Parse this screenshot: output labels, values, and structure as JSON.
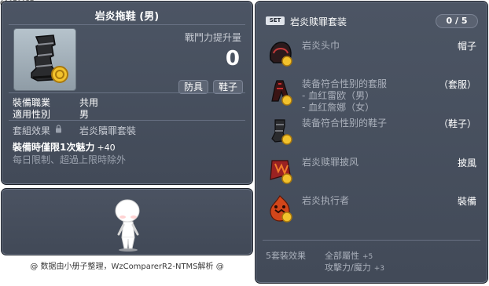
{
  "item_id": "01070057",
  "item": {
    "name": "岩炎拖鞋 (男)",
    "power_label": "戰鬥力提升量",
    "power_value": "0",
    "tags": [
      "防具",
      "鞋子"
    ],
    "stats": [
      {
        "label": "裝備職業",
        "value": "共用"
      },
      {
        "label": "適用性別",
        "value": "男"
      }
    ],
    "set_effect_label": "套組效果",
    "set_effect_value": "岩炎贖罪套裝",
    "charm_text": "裝備時僅限1次魅力",
    "charm_value": "+40",
    "limit_text": "每日限制、超過上限時除外"
  },
  "credit": "@ 数据由小册子整理，WzComparerR2-NTMS解析 @",
  "set": {
    "badge": "SET",
    "name": "岩炎赎罪套装",
    "count": "0 / 5",
    "items": [
      {
        "name": "岩炎头巾",
        "type": "帽子",
        "icon": "hood-icon",
        "lines": []
      },
      {
        "name": "装备符合性别的套服",
        "type": "（套服）",
        "icon": "suit-icon",
        "lines": [
          "- 血红雷欧（男）",
          "- 血红詹娜（女）"
        ]
      },
      {
        "name": "装备符合性别的鞋子",
        "type": "（鞋子）",
        "icon": "shoe-icon",
        "lines": []
      },
      {
        "name": "岩炎赎罪披风",
        "type": "披風",
        "icon": "cape-icon",
        "lines": []
      },
      {
        "name": "岩炎执行者",
        "type": "裝備",
        "icon": "flame-icon",
        "lines": []
      }
    ],
    "effect_label": "5套裝效果",
    "effects": [
      {
        "name": "全部屬性",
        "value": "+5"
      },
      {
        "name": "攻擊力/魔力",
        "value": "+3"
      }
    ]
  },
  "colors": {
    "panel_bg": "#464e5c",
    "panel_border": "#1d2129",
    "gold": "#f2c22c"
  }
}
